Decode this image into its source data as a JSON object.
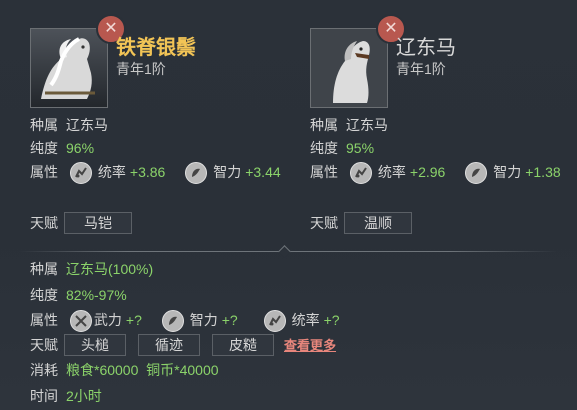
{
  "left_card": {
    "name": "铁脊银鬃",
    "age": "青年1阶",
    "breed_label": "种属",
    "breed": "辽东马",
    "purity_label": "纯度",
    "purity": "96%",
    "attr_label": "属性",
    "stats": [
      {
        "name": "统率",
        "value": "+3.86"
      },
      {
        "name": "智力",
        "value": "+3.44"
      }
    ],
    "talent_label": "天赋",
    "talent": "马铠",
    "close": "✕"
  },
  "right_card": {
    "name": "辽东马",
    "age": "青年1阶",
    "breed_label": "种属",
    "breed": "辽东马",
    "purity_label": "纯度",
    "purity": "95%",
    "attr_label": "属性",
    "stats": [
      {
        "name": "统率",
        "value": "+2.96"
      },
      {
        "name": "智力",
        "value": "+1.38"
      }
    ],
    "talent_label": "天赋",
    "talent": "温顺",
    "close": "✕"
  },
  "result": {
    "breed_label": "种属",
    "breed": "辽东马(100%)",
    "purity_label": "纯度",
    "purity": "82%-97%",
    "attr_label": "属性",
    "stats": [
      {
        "name": "武力",
        "value": "+?"
      },
      {
        "name": "智力",
        "value": "+?"
      },
      {
        "name": "统率",
        "value": "+?"
      }
    ],
    "talent_label": "天赋",
    "talents": [
      "头槌",
      "循迹",
      "皮糙"
    ],
    "more_link": "查看更多",
    "cost_label": "消耗",
    "cost": "粮食*60000  铜币*40000",
    "time_label": "时间",
    "time": "2小时"
  },
  "colors": {
    "gold_name": "#f2c456",
    "green_value": "#8bd36a",
    "link": "#e8867c",
    "close_bg": "#b8584f"
  }
}
